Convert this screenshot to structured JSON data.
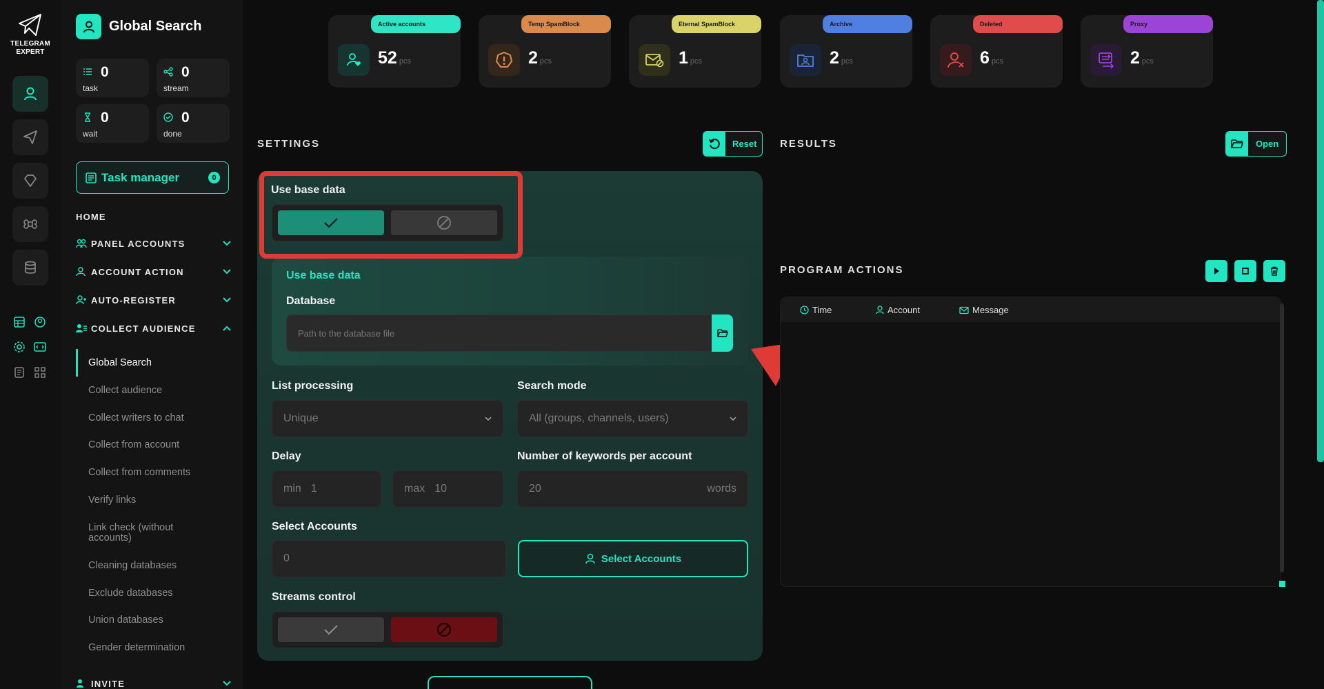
{
  "app": {
    "logo_line1": "TELEGRAM",
    "logo_line2": "EXPERT",
    "title": "Global Search"
  },
  "colors": {
    "accent": "#21e6c1",
    "danger": "#e03a36",
    "bg": "#0d0d0d"
  },
  "stats": [
    {
      "value": "0",
      "label": "task",
      "icon": "list-icon"
    },
    {
      "value": "0",
      "label": "stream",
      "icon": "share-icon"
    },
    {
      "value": "0",
      "label": "wait",
      "icon": "hourglass-icon"
    },
    {
      "value": "0",
      "label": "done",
      "icon": "check-circle-icon"
    }
  ],
  "task_manager": {
    "label": "Task manager",
    "count": "0"
  },
  "nav": {
    "home": "HOME",
    "panel_accounts": "PANEL ACCOUNTS",
    "account_action": "ACCOUNT ACTION",
    "auto_register": "AUTO-REGISTER",
    "collect_audience": "COLLECT AUDIENCE",
    "invite": "INVITE",
    "sub": [
      "Global Search",
      "Collect audience",
      "Collect writers to chat",
      "Collect from account",
      "Collect from comments",
      "Verify links",
      "Link check (without accounts)",
      "Cleaning databases",
      "Exclude databases",
      "Union databases",
      "Gender determination"
    ]
  },
  "cards": [
    {
      "label": "Active accounts",
      "value": "52",
      "unit": "pcs",
      "color": "#2ee6c6",
      "icon": "user-heart-icon"
    },
    {
      "label": "Temp SpamBlock",
      "value": "2",
      "unit": "pcs",
      "color": "#d98a4c",
      "icon": "warning-icon"
    },
    {
      "label": "Eternal SpamBlock",
      "value": "1",
      "unit": "pcs",
      "color": "#d9d36a",
      "icon": "mail-block-icon"
    },
    {
      "label": "Archive",
      "value": "2",
      "unit": "pcs",
      "color": "#4f7fe0",
      "icon": "archive-icon"
    },
    {
      "label": "Deleted",
      "value": "6",
      "unit": "pcs",
      "color": "#e04b4b",
      "icon": "user-x-icon"
    },
    {
      "label": "Proxy",
      "value": "2",
      "unit": "pcs",
      "color": "#9b44d6",
      "icon": "proxy-icon"
    }
  ],
  "settings": {
    "title": "SETTINGS",
    "reset": "Reset",
    "use_base_data": "Use base data",
    "inner_title": "Use base data",
    "database_label": "Database",
    "database_placeholder": "Path to the database file",
    "list_processing_label": "List processing",
    "list_processing_value": "Unique",
    "search_mode_label": "Search mode",
    "search_mode_value": "All (groups, channels, users)",
    "delay_label": "Delay",
    "delay_min_prefix": "min",
    "delay_min": "1",
    "delay_max_prefix": "max",
    "delay_max": "10",
    "keywords_label": "Number of keywords per account",
    "keywords_value": "20",
    "keywords_unit": "words",
    "select_accounts_label": "Select Accounts",
    "select_accounts_value": "0",
    "select_accounts_button": "Select Accounts",
    "streams_label": "Streams control"
  },
  "results": {
    "title": "RESULTS",
    "open": "Open"
  },
  "program_actions": {
    "title": "PROGRAM ACTIONS",
    "columns": [
      "Time",
      "Account",
      "Message"
    ]
  }
}
